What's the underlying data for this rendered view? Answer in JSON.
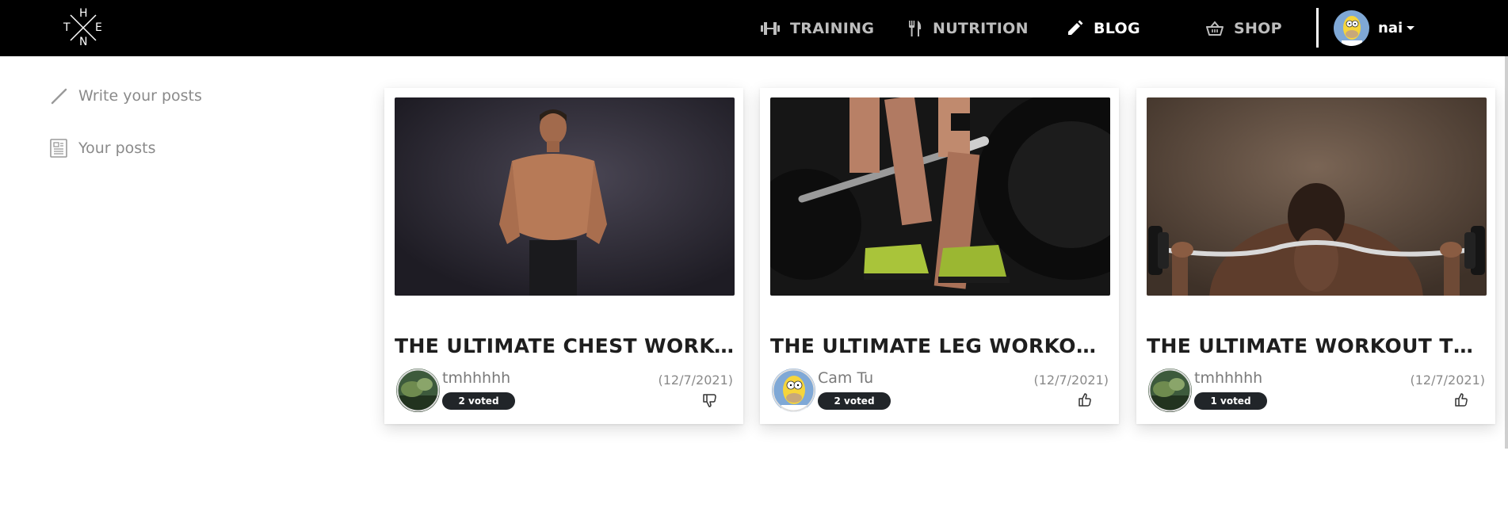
{
  "logo": {
    "letters": [
      "H",
      "T",
      "E",
      "N"
    ]
  },
  "nav": {
    "training": {
      "label": "TRAINING",
      "icon": "dumbbell-icon"
    },
    "nutrition": {
      "label": "NUTRITION",
      "icon": "fork-knife-icon"
    },
    "blog": {
      "label": "BLOG",
      "icon": "pencil-icon",
      "active": true
    },
    "shop": {
      "label": "SHOP",
      "icon": "basket-icon"
    }
  },
  "user": {
    "name": "nai",
    "avatar": "homer-avatar"
  },
  "sidebar": {
    "items": [
      {
        "label": "Write your posts",
        "icon": "pencil-icon"
      },
      {
        "label": "Your posts",
        "icon": "document-icon"
      }
    ]
  },
  "posts": [
    {
      "title": "THE ULTIMATE CHEST WORKO...",
      "author": "tmhhhhh",
      "votes": "2 voted",
      "date": "(12/7/2021)",
      "vote_icon": "thumbs-down-icon",
      "image": "shirtless-man-photo"
    },
    {
      "title": "THE ULTIMATE LEG WORKOUT ...",
      "author": "Cam Tu",
      "votes": "2 voted",
      "date": "(12/7/2021)",
      "vote_icon": "thumbs-up-icon",
      "image": "deadlift-legs-photo"
    },
    {
      "title": "THE ULTIMATE WORKOUT TO ...",
      "author": "tmhhhhh",
      "votes": "1 voted",
      "date": "(12/7/2021)",
      "vote_icon": "thumbs-up-icon",
      "image": "barbell-back-photo"
    }
  ],
  "colors": {
    "topbar": "#000000",
    "badge": "#212529",
    "muted_text": "#8a8a8a"
  }
}
